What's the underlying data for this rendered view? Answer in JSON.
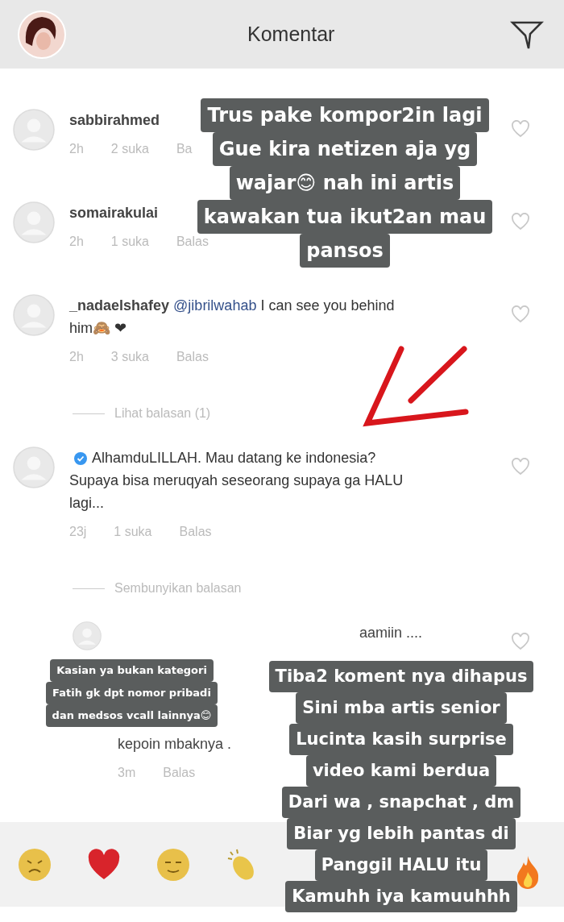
{
  "header": {
    "title": "Komentar"
  },
  "comments": [
    {
      "kind": "comment",
      "username": "sabbirahmed",
      "time": "2h",
      "likes": "2 suka",
      "reply": "Ba",
      "liked": false
    },
    {
      "kind": "comment",
      "username": "somairakulai",
      "time": "2h",
      "likes": "1 suka",
      "reply": "Balas",
      "liked": false
    },
    {
      "kind": "comment",
      "username": "_nadaelshafey",
      "mention": "@jibrilwahab",
      "text": "I can see you behind him🙈 ❤",
      "time": "2h",
      "likes": "3 suka",
      "reply": "Balas",
      "liked": false
    },
    {
      "kind": "toggle",
      "label": "Lihat balasan (1)"
    },
    {
      "kind": "comment",
      "verified": true,
      "text": "AlhamduLILLAH. Mau datang ke indonesia? Supaya bisa meruqyah seseorang supaya ga HALU lagi...",
      "time": "23j",
      "likes": "1 suka",
      "reply": "Balas",
      "liked": false
    },
    {
      "kind": "toggle",
      "label": "Sembunyikan balasan"
    },
    {
      "kind": "reply",
      "text": "aamiin ....",
      "liked": false
    },
    {
      "kind": "reply",
      "text": "kepoin mbaknya .",
      "time": "3m",
      "reply": "Balas"
    }
  ],
  "captions": [
    {
      "lines": [
        "Trus pake kompor2in lagi",
        "Gue kira netizen aja yg",
        "wajar😊 nah ini artis",
        "kawakan tua ikut2an mau",
        "pansos"
      ]
    },
    {
      "lines": [
        "Kasian ya bukan kategori",
        "Fatih gk dpt nomor pribadi",
        "dan medsos vcall lainnya😊"
      ]
    },
    {
      "lines": [
        "Tiba2 koment nya dihapus",
        "Sini mba artis senior",
        "Lucinta kasih surprise",
        "video kami berdua",
        "Dari wa , snapchat , dm",
        "Biar yg lebih pantas di",
        "Panggil HALU itu",
        "Kamuhh iya kamuuhhh"
      ]
    }
  ]
}
